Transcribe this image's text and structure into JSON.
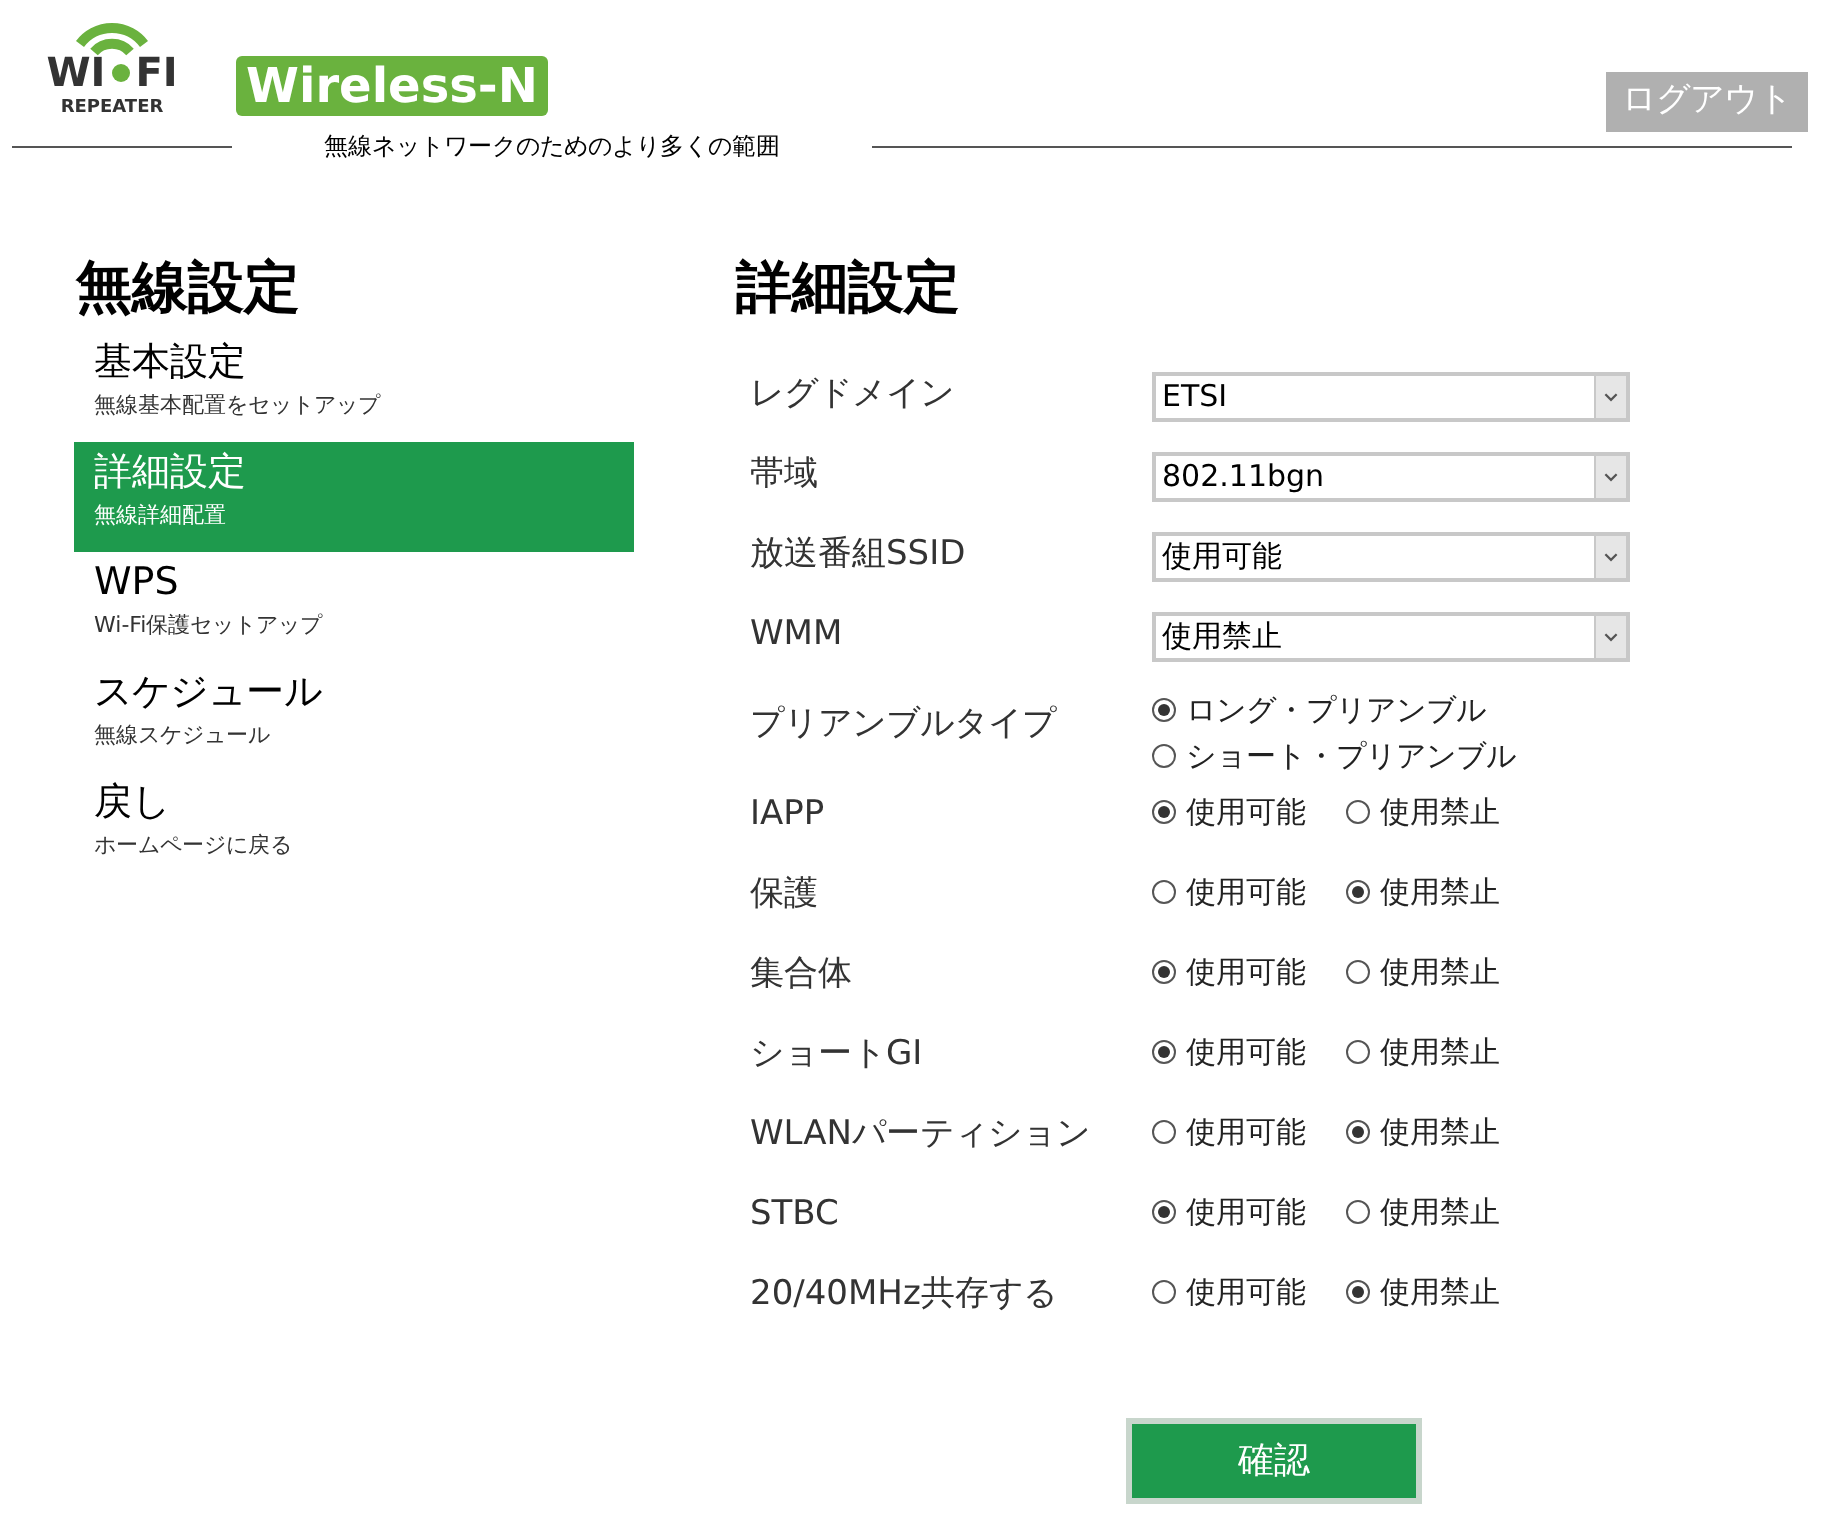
{
  "header": {
    "logo": {
      "left": "WI",
      "right": "FI",
      "sub": "REPEATER"
    },
    "badge": "Wireless-N",
    "tagline": "無線ネットワークのためのより多くの範囲",
    "logout": "ログアウト"
  },
  "sidebar": {
    "title": "無線設定",
    "items": [
      {
        "label": "基本設定",
        "sub": "無線基本配置をセットアップ",
        "selected": false
      },
      {
        "label": "詳細設定",
        "sub": "無線詳細配置",
        "selected": true
      },
      {
        "label": "WPS",
        "sub": "Wi-Fi保護セットアップ",
        "selected": false
      },
      {
        "label": "スケジュール",
        "sub": "無線スケジュール",
        "selected": false
      },
      {
        "label": "戻し",
        "sub": "ホームページに戻る",
        "selected": false
      }
    ]
  },
  "main": {
    "title": "詳細設定",
    "rows": [
      {
        "kind": "select",
        "label": "レグドメイン",
        "value": "ETSI"
      },
      {
        "kind": "select",
        "label": "帯域",
        "value": "802.11bgn"
      },
      {
        "kind": "select",
        "label": "放送番組SSID",
        "value": "使用可能"
      },
      {
        "kind": "select",
        "label": "WMM",
        "value": "使用禁止"
      },
      {
        "kind": "radio",
        "label": "プリアンブルタイプ",
        "options": [
          {
            "label": "ロング・プリアンブル",
            "selected": true
          },
          {
            "label": "ショート・プリアンブル",
            "selected": false
          }
        ]
      },
      {
        "kind": "radio",
        "label": "IAPP",
        "options": [
          {
            "label": "使用可能",
            "selected": true
          },
          {
            "label": "使用禁止",
            "selected": false
          }
        ]
      },
      {
        "kind": "radio",
        "label": "保護",
        "options": [
          {
            "label": "使用可能",
            "selected": false
          },
          {
            "label": "使用禁止",
            "selected": true
          }
        ]
      },
      {
        "kind": "radio",
        "label": "集合体",
        "options": [
          {
            "label": "使用可能",
            "selected": true
          },
          {
            "label": "使用禁止",
            "selected": false
          }
        ]
      },
      {
        "kind": "radio",
        "label": "ショートGI",
        "options": [
          {
            "label": "使用可能",
            "selected": true
          },
          {
            "label": "使用禁止",
            "selected": false
          }
        ]
      },
      {
        "kind": "radio",
        "label": "WLANパーティション",
        "options": [
          {
            "label": "使用可能",
            "selected": false
          },
          {
            "label": "使用禁止",
            "selected": true
          }
        ]
      },
      {
        "kind": "radio",
        "label": "STBC",
        "options": [
          {
            "label": "使用可能",
            "selected": true
          },
          {
            "label": "使用禁止",
            "selected": false
          }
        ]
      },
      {
        "kind": "radio",
        "label": "20/40MHz共存する",
        "options": [
          {
            "label": "使用可能",
            "selected": false
          },
          {
            "label": "使用禁止",
            "selected": true
          }
        ]
      }
    ],
    "confirm": "確認"
  }
}
